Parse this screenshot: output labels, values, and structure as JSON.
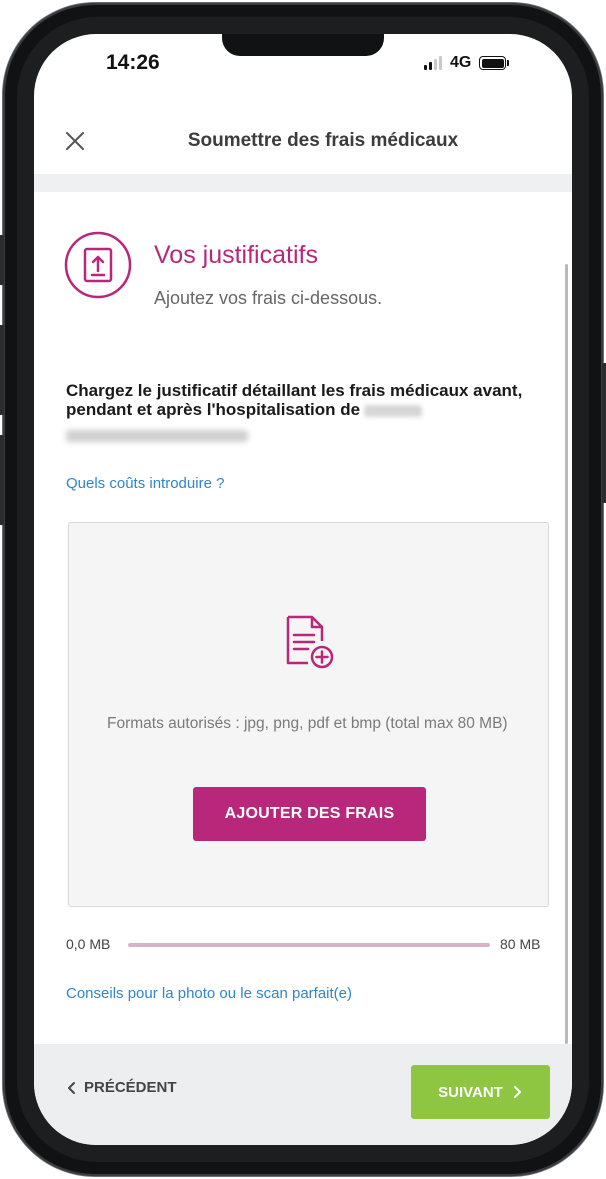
{
  "status_bar": {
    "time": "14:26",
    "network": "4G",
    "signal_bars_active": 2,
    "battery_level": 1.0
  },
  "header": {
    "title": "Soumettre des frais médicaux",
    "close_icon": "close-icon"
  },
  "section": {
    "icon": "document-upload-icon",
    "title": "Vos justificatifs",
    "subtitle": "Ajoutez vos frais ci-dessous."
  },
  "instruction": {
    "text": "Chargez le justificatif détaillant les frais médicaux avant, pendant et après l'hospitalisation de"
  },
  "links": {
    "costs": "Quels coûts introduire ?",
    "tips": "Conseils pour la photo ou le scan parfait(e)"
  },
  "upload": {
    "icon": "file-add-icon",
    "formats": "Formats autorisés : jpg, png, pdf et bmp (total max 80 MB)",
    "button_label": "AJOUTER DES FRAIS"
  },
  "size": {
    "min_label": "0,0 MB",
    "max_label": "80 MB",
    "used_fraction": 0.0
  },
  "footer": {
    "prev_label": "PRÉCÉDENT",
    "next_label": "SUIVANT"
  },
  "colors": {
    "accent": "#b8277a",
    "link": "#2f86c8",
    "next_button": "#8ec641",
    "footer_bg": "#eceeef"
  }
}
